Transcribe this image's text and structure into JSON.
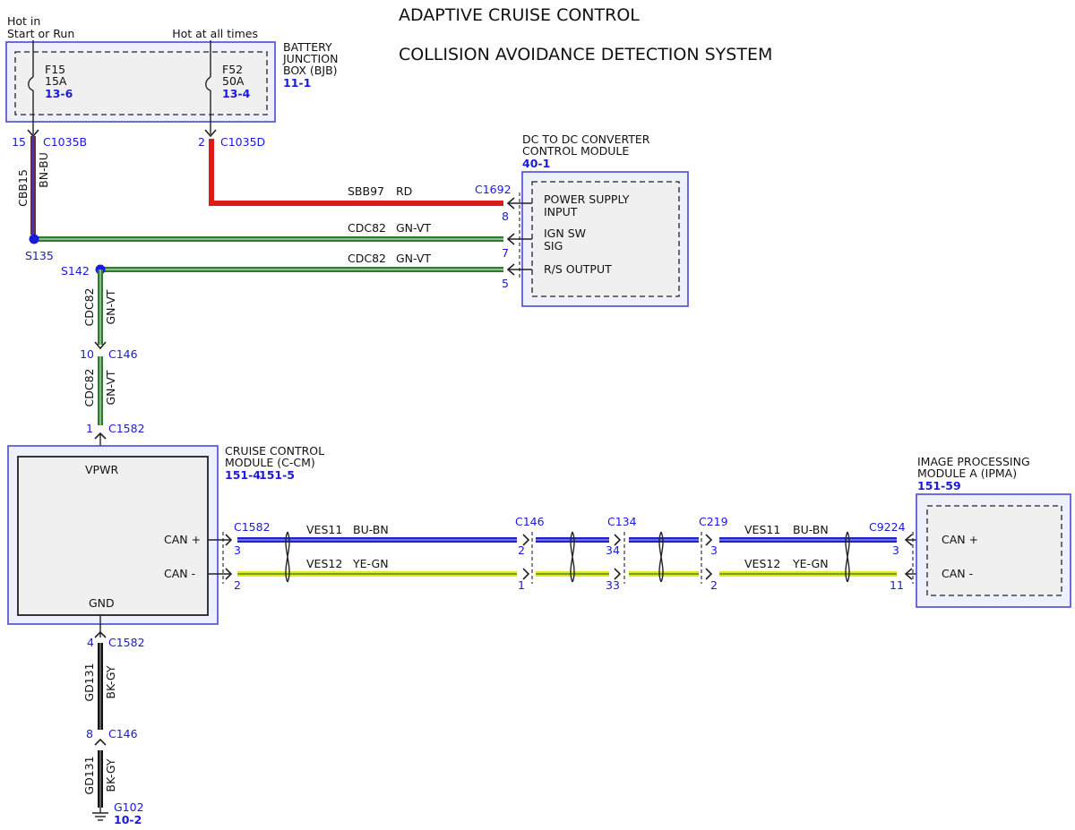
{
  "title": {
    "line1": "ADAPTIVE CRUISE CONTROL",
    "line2": "COLLISION AVOIDANCE DETECTION SYSTEM"
  },
  "colors": {
    "red": "#e01919",
    "purple": "#6a2a48",
    "green": "#2f7a2f",
    "blue": "#2222cc",
    "yellow": "#e6e61a",
    "black": "#111111",
    "connector_blue": "#1a1adb",
    "frame": "#4a4ad8"
  },
  "power": {
    "hot_start_run": [
      "Hot in",
      "Start or Run"
    ],
    "hot_all_times": "Hot at all times"
  },
  "bjb": {
    "label": [
      "BATTERY",
      "JUNCTION",
      "BOX (BJB)"
    ],
    "ref": "11-1",
    "fuse_left": {
      "name": "F15",
      "rating": "15A",
      "ref": "13-6"
    },
    "fuse_right": {
      "name": "F52",
      "rating": "50A",
      "ref": "13-4"
    }
  },
  "connectors": {
    "c1035b": {
      "pin": "15",
      "name": "C1035B"
    },
    "c1035d": {
      "pin": "2",
      "name": "C1035D"
    },
    "c1692": {
      "name": "C1692"
    },
    "c146_top": {
      "pin": "10",
      "name": "C146"
    },
    "c1582_top": {
      "pin": "1",
      "name": "C1582"
    },
    "c1582_can": {
      "name": "C1582",
      "pin_plus": "3",
      "pin_minus": "2"
    },
    "c146_can": {
      "name": "C146",
      "pin_plus": "2",
      "pin_minus": "1"
    },
    "c134_can": {
      "name": "C134",
      "pin_plus": "34",
      "pin_minus": "33"
    },
    "c219_can": {
      "name": "C219",
      "pin_plus": "3",
      "pin_minus": "2"
    },
    "c9224_can": {
      "name": "C9224",
      "pin_plus": "3",
      "pin_minus": "11"
    },
    "c1582_bot": {
      "pin": "4",
      "name": "C1582"
    },
    "c146_bot": {
      "pin": "8",
      "name": "C146"
    }
  },
  "splices": {
    "s135": "S135",
    "s142": "S142"
  },
  "wires": {
    "cbb15": {
      "circuit": "CBB15",
      "color": "BN-BU"
    },
    "sbb97": {
      "circuit": "SBB97",
      "color": "RD"
    },
    "cdc82_a": {
      "circuit": "CDC82",
      "color": "GN-VT"
    },
    "cdc82_b": {
      "circuit": "CDC82",
      "color": "GN-VT"
    },
    "cdc82_c": {
      "circuit": "CDC82",
      "color": "GN-VT"
    },
    "cdc82_d": {
      "circuit": "CDC82",
      "color": "GN-VT"
    },
    "ves11_left": {
      "circuit": "VES11",
      "color": "BU-BN"
    },
    "ves12_left": {
      "circuit": "VES12",
      "color": "YE-GN"
    },
    "ves11_right": {
      "circuit": "VES11",
      "color": "BU-BN"
    },
    "ves12_right": {
      "circuit": "VES12",
      "color": "YE-GN"
    },
    "gd131_a": {
      "circuit": "GD131",
      "color": "BK-GY"
    },
    "gd131_b": {
      "circuit": "GD131",
      "color": "BK-GY"
    }
  },
  "dcdc": {
    "label": [
      "DC TO DC CONVERTER",
      "CONTROL MODULE"
    ],
    "ref": "40-1",
    "pin_power": "8",
    "pin_ign": "7",
    "pin_rs": "5",
    "power_supply": [
      "POWER SUPPLY",
      "INPUT"
    ],
    "ign_sw": [
      "IGN SW",
      "SIG"
    ],
    "rs_output": "R/S OUTPUT"
  },
  "ccm": {
    "label": [
      "CRUISE CONTROL",
      "MODULE (C-CM)"
    ],
    "ref1": "151-4",
    "ref2": "151-5",
    "vpwr": "VPWR",
    "can_plus": "CAN +",
    "can_minus": "CAN -",
    "gnd": "GND"
  },
  "ipma": {
    "label": [
      "IMAGE PROCESSING",
      "MODULE A (IPMA)"
    ],
    "ref": "151-59",
    "can_plus": "CAN +",
    "can_minus": "CAN -"
  },
  "ground": {
    "name": "G102",
    "ref": "10-2"
  }
}
